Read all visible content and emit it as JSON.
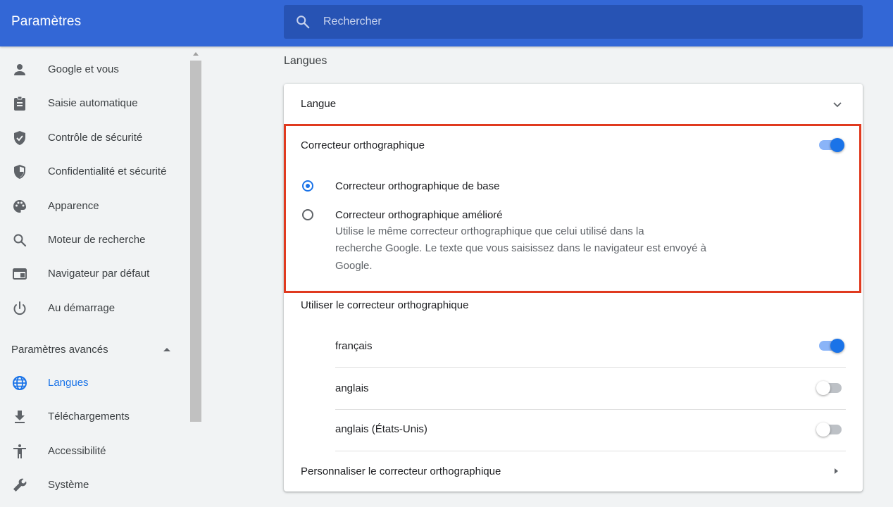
{
  "header": {
    "title": "Paramètres",
    "search_placeholder": "Rechercher"
  },
  "sidebar": {
    "items": [
      {
        "label": "Google et vous",
        "icon": "person-icon"
      },
      {
        "label": "Saisie automatique",
        "icon": "clipboard-icon"
      },
      {
        "label": "Contrôle de sécurité",
        "icon": "shield-check-icon"
      },
      {
        "label": "Confidentialité et sécurité",
        "icon": "shield-icon"
      },
      {
        "label": "Apparence",
        "icon": "palette-icon"
      },
      {
        "label": "Moteur de recherche",
        "icon": "search-icon"
      },
      {
        "label": "Navigateur par défaut",
        "icon": "browser-icon"
      },
      {
        "label": "Au démarrage",
        "icon": "power-icon"
      }
    ],
    "advanced_label": "Paramètres avancés",
    "advanced_items": [
      {
        "label": "Langues",
        "icon": "globe-icon",
        "active": true
      },
      {
        "label": "Téléchargements",
        "icon": "download-icon"
      },
      {
        "label": "Accessibilité",
        "icon": "accessibility-icon"
      },
      {
        "label": "Système",
        "icon": "wrench-icon"
      }
    ]
  },
  "main": {
    "section_title": "Langues",
    "language_row": "Langue",
    "spellcheck": {
      "label": "Correcteur orthographique",
      "enabled": true,
      "basic_label": "Correcteur orthographique de base",
      "enhanced_label": "Correcteur orthographique amélioré",
      "enhanced_desc_1": "Utilise le même correcteur orthographique que celui utilisé dans la",
      "enhanced_desc_2": "recherche Google. Le texte que vous saisissez dans le navigateur est envoyé à",
      "enhanced_desc_3": "Google.",
      "selected": "basic"
    },
    "use_spellcheck_label": "Utiliser le correcteur orthographique",
    "languages": [
      {
        "name": "français",
        "enabled": true
      },
      {
        "name": "anglais",
        "enabled": false
      },
      {
        "name": "anglais (États-Unis)",
        "enabled": false
      }
    ],
    "customize_label": "Personnaliser le correcteur orthographique"
  },
  "colors": {
    "header": "#3367d6",
    "accent": "#1a73e8",
    "highlight_border": "#e03a1f"
  }
}
